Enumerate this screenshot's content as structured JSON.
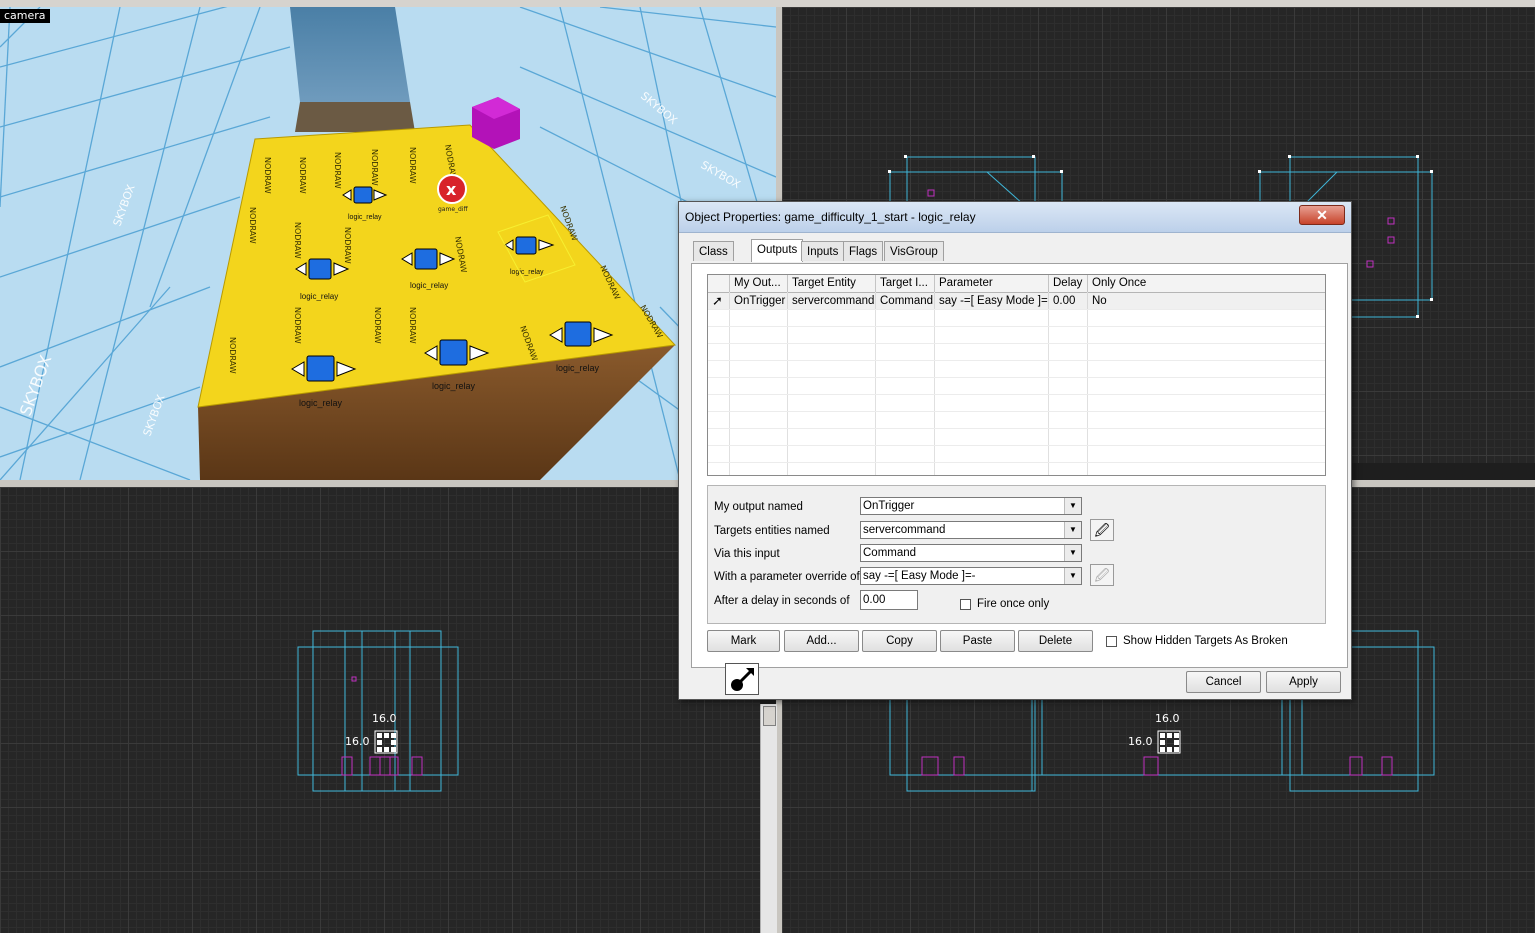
{
  "viewports": {
    "camera_label": "camera",
    "coord_front_top": "16.0",
    "coord_front_left": "16.0",
    "coord_side_top": "16.0",
    "coord_side_left": "16.0"
  },
  "scene": {
    "sky_text": "SKYBOX",
    "floor_text": "NODRAW",
    "entity_label": "logic_relay",
    "entity_label_small": "game_diff"
  },
  "dialog": {
    "title": "Object Properties: game_difficulty_1_start - logic_relay",
    "close_label": "✕",
    "tabs": [
      {
        "label": "Class Info"
      },
      {
        "label": "Outputs"
      },
      {
        "label": "Inputs"
      },
      {
        "label": "Flags"
      },
      {
        "label": "VisGroup"
      }
    ],
    "table": {
      "columns": [
        "My Out...",
        "Target Entity",
        "Target I...",
        "Parameter",
        "Delay",
        "Only Once"
      ],
      "rows": [
        {
          "output": "OnTrigger",
          "target": "servercommand",
          "input": "Command",
          "parameter": "say -=[ Easy Mode ]=-",
          "delay": "0.00",
          "only_once": "No"
        }
      ]
    },
    "form": {
      "output_label": "My output named",
      "output_value": "OnTrigger",
      "target_label": "Targets entities named",
      "target_value": "servercommand",
      "input_label": "Via this input",
      "input_value": "Command",
      "param_label": "With a parameter override of",
      "param_value": "say -=[ Easy Mode ]=-",
      "delay_label": "After a delay in seconds of",
      "delay_value": "0.00",
      "fire_once_label": "Fire once only"
    },
    "buttons": {
      "mark": "Mark",
      "add": "Add...",
      "copy": "Copy",
      "paste": "Paste",
      "delete": "Delete",
      "show_hidden_label": "Show Hidden Targets As Broken",
      "cancel": "Cancel",
      "apply": "Apply"
    },
    "icons": {
      "row_icon": "output-arrow-icon",
      "pick_icon": "eyedropper-icon",
      "bottom_icon": "entity-output-icon"
    }
  }
}
